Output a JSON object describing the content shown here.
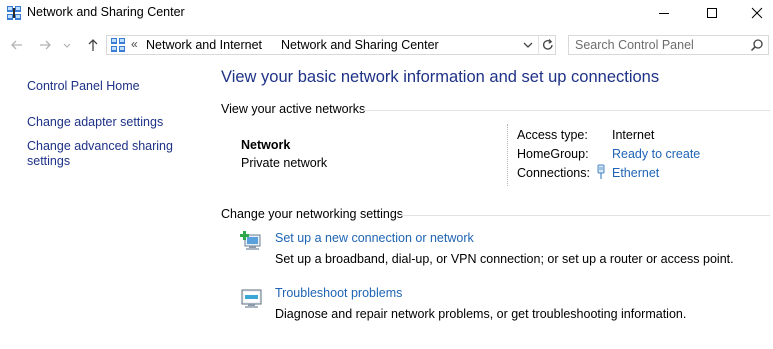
{
  "window": {
    "title": "Network and Sharing Center",
    "icon": "network-sharing-icon",
    "controls": {
      "minimize_icon": "minimize-icon",
      "maximize_icon": "maximize-icon",
      "close_icon": "close-icon"
    }
  },
  "address_bar": {
    "overflow_chevron": "«",
    "breadcrumbs": [
      "Network and Internet",
      "Network and Sharing Center"
    ],
    "separator": "›"
  },
  "search": {
    "placeholder": "Search Control Panel",
    "value": ""
  },
  "left_pane": {
    "links": [
      "Control Panel Home",
      "Change adapter settings",
      "Change advanced sharing settings"
    ]
  },
  "main": {
    "heading": "View your basic network information and set up connections",
    "active_networks": {
      "section_label": "View your active networks",
      "network_name": "Network",
      "network_type": "Private network",
      "access_type_label": "Access type:",
      "access_type_value": "Internet",
      "homegroup_label": "HomeGroup:",
      "homegroup_value": "Ready to create",
      "connections_label": "Connections:",
      "connections_value": "Ethernet",
      "connections_icon": "ethernet-icon"
    },
    "networking_settings": {
      "section_label": "Change your networking settings",
      "tasks": [
        {
          "icon": "new-connection-icon",
          "title": "Set up a new connection or network",
          "description": "Set up a broadband, dial-up, or VPN connection; or set up a router or access point."
        },
        {
          "icon": "troubleshoot-icon",
          "title": "Troubleshoot problems",
          "description": "Diagnose and repair network problems, or get troubleshooting information."
        }
      ]
    }
  },
  "colors": {
    "heading": "#1e3287",
    "link": "#1e64b4",
    "divider": "#e2e2e2"
  }
}
